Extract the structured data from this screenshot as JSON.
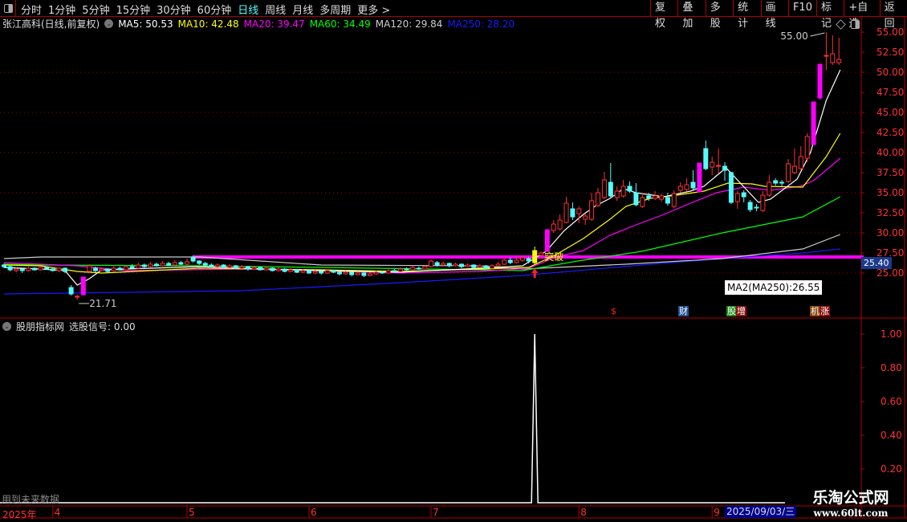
{
  "toolbar": {
    "tabs": [
      "分时",
      "1分钟",
      "5分钟",
      "15分钟",
      "30分钟",
      "60分钟",
      "日线",
      "周线",
      "月线",
      "多周期",
      "更多 >"
    ],
    "active_tab": "日线",
    "buttons": [
      "复权",
      "叠加",
      "多股",
      "统计",
      "画线",
      "F10",
      "标记",
      "+自选",
      "返回"
    ]
  },
  "info": {
    "title": "张江高科(日线,前复权)",
    "ma": [
      {
        "label": "MA5: 50.53",
        "color": "#ffffff"
      },
      {
        "label": "MA10: 42.48",
        "color": "#ffff00"
      },
      {
        "label": "MA20: 39.47",
        "color": "#ff00ff"
      },
      {
        "label": "MA60: 34.49",
        "color": "#00ff00"
      },
      {
        "label": "MA120: 29.84",
        "color": "#cccccc"
      },
      {
        "label": "MA250: 28.20",
        "color": "#1a1aff"
      }
    ]
  },
  "indicator": {
    "name": "股朋指标网",
    "signal_label": "选股信号: 0.00"
  },
  "annotations": {
    "high_label": "55.00",
    "low_label": "21.71",
    "breakout_label": "突破",
    "tooltip": "MA2(MA250):26.55",
    "current_price": "25.40",
    "future_warning": "用到未来数据",
    "year": "2025年",
    "date_box": "2025/09/03/三"
  },
  "event_badges": [
    {
      "text": "$",
      "color": "#ff2020",
      "bg": "transparent"
    },
    {
      "text": "财",
      "color": "#ffffff",
      "bg": "#1f4f8f"
    },
    {
      "text": "股",
      "color": "#ffffff",
      "bg": "#1a8a1a"
    },
    {
      "text": "增",
      "color": "#ffffff",
      "bg": "#8a1010"
    },
    {
      "text": "机",
      "color": "#ffffff",
      "bg": "#8a4a10"
    },
    {
      "text": "涨",
      "color": "#ffffff",
      "bg": "#8a1010"
    }
  ],
  "watermark": {
    "line1": "乐淘公式网",
    "line2": "www.60lt.com"
  },
  "chart_data": {
    "type": "candlestick",
    "price_axis": {
      "ticks": [
        55.0,
        52.5,
        50.0,
        47.5,
        45.0,
        42.5,
        40.0,
        37.5,
        35.0,
        32.5,
        30.0,
        27.5,
        25.0
      ],
      "grid": [
        50,
        45,
        40,
        35,
        30,
        25
      ]
    },
    "months": [
      "4",
      "5",
      "6",
      "7",
      "8",
      "9"
    ],
    "month_start_index": [
      8,
      30,
      50,
      70,
      94,
      115
    ],
    "resistance_level": 27.0,
    "resistance_start_index": 31,
    "candles": [
      [
        26.0,
        25.8,
        26.2,
        25.6
      ],
      [
        25.8,
        25.4,
        25.9,
        25.2
      ],
      [
        25.3,
        25.5,
        25.7,
        25.1
      ],
      [
        25.5,
        25.3,
        25.6,
        25.0
      ],
      [
        25.3,
        25.6,
        25.8,
        25.2
      ],
      [
        25.6,
        25.4,
        25.7,
        25.3
      ],
      [
        25.4,
        25.7,
        25.9,
        25.3
      ],
      [
        25.7,
        25.5,
        25.8,
        25.4
      ],
      [
        25.5,
        25.3,
        25.6,
        25.2
      ],
      [
        25.3,
        25.6,
        25.7,
        25.1
      ],
      [
        25.6,
        25.2,
        25.7,
        25.0
      ],
      [
        23.2,
        22.4,
        23.5,
        22.2
      ],
      [
        22.0,
        22.1,
        22.3,
        21.71
      ],
      [
        22.3,
        24.5,
        24.5,
        22.3
      ],
      [
        25.2,
        25.9,
        26.1,
        25.0
      ],
      [
        25.6,
        25.3,
        25.8,
        25.1
      ],
      [
        25.3,
        25.5,
        25.7,
        25.2
      ],
      [
        25.5,
        25.2,
        25.6,
        25.0
      ],
      [
        25.3,
        25.6,
        26.0,
        25.2
      ],
      [
        25.6,
        25.4,
        25.8,
        25.3
      ],
      [
        25.4,
        25.8,
        26.0,
        25.3
      ],
      [
        25.8,
        25.6,
        26.1,
        25.5
      ],
      [
        25.6,
        26.0,
        26.3,
        25.5
      ],
      [
        26.0,
        25.8,
        26.2,
        25.6
      ],
      [
        25.8,
        26.1,
        26.4,
        25.7
      ],
      [
        26.1,
        25.9,
        26.3,
        25.8
      ],
      [
        25.9,
        26.2,
        26.5,
        25.8
      ],
      [
        26.2,
        26.0,
        26.4,
        25.9
      ],
      [
        26.0,
        26.3,
        26.6,
        25.9
      ],
      [
        26.3,
        26.1,
        26.5,
        26.0
      ],
      [
        26.1,
        26.4,
        26.8,
        26.0
      ],
      [
        26.9,
        26.5,
        27.2,
        26.3
      ],
      [
        26.5,
        26.2,
        26.6,
        26.0
      ],
      [
        26.2,
        26.0,
        26.4,
        25.8
      ],
      [
        26.0,
        25.8,
        26.2,
        25.7
      ],
      [
        25.8,
        26.0,
        26.2,
        25.6
      ],
      [
        26.0,
        25.7,
        26.1,
        25.5
      ],
      [
        25.7,
        25.9,
        26.1,
        25.6
      ],
      [
        25.9,
        25.6,
        26.0,
        25.5
      ],
      [
        25.6,
        25.8,
        26.0,
        25.5
      ],
      [
        25.8,
        25.5,
        25.9,
        25.3
      ],
      [
        25.5,
        25.7,
        25.9,
        25.4
      ],
      [
        25.7,
        25.4,
        25.8,
        25.3
      ],
      [
        25.4,
        25.6,
        25.8,
        25.3
      ],
      [
        25.6,
        25.3,
        25.7,
        25.2
      ],
      [
        25.3,
        25.5,
        25.7,
        25.2
      ],
      [
        25.5,
        25.2,
        25.6,
        25.1
      ],
      [
        25.2,
        25.4,
        25.6,
        25.1
      ],
      [
        25.4,
        25.1,
        25.5,
        25.0
      ],
      [
        25.1,
        25.3,
        25.5,
        25.0
      ],
      [
        25.3,
        25.0,
        25.4,
        24.9
      ],
      [
        25.0,
        25.2,
        25.4,
        24.9
      ],
      [
        25.2,
        25.0,
        25.3,
        24.8
      ],
      [
        25.0,
        25.3,
        25.5,
        24.9
      ],
      [
        25.3,
        25.1,
        25.4,
        25.0
      ],
      [
        25.1,
        24.9,
        25.2,
        24.7
      ],
      [
        24.9,
        25.1,
        25.3,
        24.8
      ],
      [
        25.1,
        24.8,
        25.2,
        24.6
      ],
      [
        24.8,
        25.0,
        25.2,
        24.7
      ],
      [
        25.0,
        24.7,
        25.1,
        24.5
      ],
      [
        24.7,
        24.9,
        25.1,
        24.6
      ],
      [
        24.9,
        25.1,
        25.3,
        24.8
      ],
      [
        25.1,
        25.0,
        25.3,
        24.9
      ],
      [
        25.0,
        25.3,
        25.5,
        24.9
      ],
      [
        25.3,
        25.2,
        25.5,
        25.0
      ],
      [
        25.2,
        25.5,
        25.7,
        25.1
      ],
      [
        25.5,
        25.4,
        25.7,
        25.3
      ],
      [
        25.4,
        25.7,
        25.9,
        25.3
      ],
      [
        25.6,
        25.5,
        25.8,
        25.4
      ],
      [
        25.5,
        25.8,
        26.0,
        25.4
      ],
      [
        25.8,
        26.5,
        26.7,
        25.7
      ],
      [
        26.3,
        26.0,
        26.5,
        25.8
      ],
      [
        26.0,
        26.2,
        26.4,
        25.9
      ],
      [
        26.2,
        25.9,
        26.3,
        25.7
      ],
      [
        25.9,
        26.1,
        26.3,
        25.8
      ],
      [
        26.1,
        25.8,
        26.2,
        25.6
      ],
      [
        25.8,
        26.0,
        26.2,
        25.7
      ],
      [
        26.0,
        25.7,
        26.1,
        25.5
      ],
      [
        25.7,
        25.9,
        26.1,
        25.6
      ],
      [
        25.9,
        25.6,
        26.0,
        25.5
      ],
      [
        25.6,
        25.9,
        26.1,
        25.5
      ],
      [
        25.9,
        26.1,
        26.4,
        25.8
      ],
      [
        26.1,
        26.6,
        26.8,
        26.0
      ],
      [
        26.6,
        26.3,
        26.9,
        26.1
      ],
      [
        26.3,
        26.6,
        27.2,
        26.2
      ],
      [
        26.6,
        26.9,
        27.1,
        26.4
      ],
      [
        26.8,
        26.5,
        27.0,
        26.2
      ],
      [
        26.3,
        27.8,
        28.3,
        26.0
      ],
      [
        27.2,
        27.5,
        27.7,
        27.0
      ],
      [
        27.7,
        30.4,
        30.4,
        27.7
      ],
      [
        30.3,
        31.1,
        31.6,
        30.0
      ],
      [
        30.5,
        31.6,
        32.3,
        30.3
      ],
      [
        31.3,
        33.7,
        34.5,
        31.2
      ],
      [
        33.0,
        32.0,
        33.8,
        31.6
      ],
      [
        32.4,
        33.0,
        33.3,
        31.2
      ],
      [
        31.7,
        32.1,
        32.4,
        31.0
      ],
      [
        31.7,
        34.0,
        35.0,
        31.5
      ],
      [
        33.4,
        35.0,
        35.6,
        33.2
      ],
      [
        34.4,
        36.6,
        37.6,
        34.2
      ],
      [
        36.3,
        34.6,
        38.7,
        34.3
      ],
      [
        34.4,
        35.2,
        35.8,
        34.0
      ],
      [
        34.6,
        35.8,
        36.6,
        34.4
      ],
      [
        35.8,
        35.2,
        36.4,
        35.0
      ],
      [
        35.0,
        33.5,
        36.2,
        33.3
      ],
      [
        33.3,
        34.4,
        35.0,
        33.1
      ],
      [
        34.6,
        34.3,
        35.0,
        34.0
      ],
      [
        34.3,
        34.6,
        35.2,
        34.1
      ],
      [
        34.2,
        34.6,
        34.9,
        33.9
      ],
      [
        34.4,
        33.7,
        35.0,
        33.4
      ],
      [
        33.3,
        34.9,
        35.3,
        33.1
      ],
      [
        35.3,
        35.8,
        36.3,
        35.0
      ],
      [
        35.4,
        36.0,
        36.8,
        35.2
      ],
      [
        36.3,
        35.6,
        37.8,
        35.4
      ],
      [
        35.1,
        38.7,
        38.7,
        35.1
      ],
      [
        40.5,
        38.0,
        41.5,
        37.8
      ],
      [
        38.2,
        38.8,
        39.5,
        37.2
      ],
      [
        38.3,
        38.4,
        40.5,
        37.4
      ],
      [
        38.3,
        37.8,
        38.8,
        36.5
      ],
      [
        37.5,
        33.8,
        37.6,
        33.6
      ],
      [
        33.9,
        34.9,
        35.2,
        33.0
      ],
      [
        35.0,
        34.5,
        35.3,
        33.8
      ],
      [
        33.8,
        32.9,
        34.1,
        32.6
      ],
      [
        33.2,
        33.1,
        33.6,
        32.7
      ],
      [
        32.8,
        34.7,
        35.2,
        32.6
      ],
      [
        34.7,
        36.3,
        37.2,
        34.5
      ],
      [
        36.5,
        36.2,
        36.8,
        35.9
      ],
      [
        36.3,
        36.2,
        36.6,
        35.8
      ],
      [
        36.4,
        38.6,
        39.2,
        36.2
      ],
      [
        37.5,
        38.3,
        40.5,
        37.3
      ],
      [
        38.0,
        39.5,
        40.8,
        37.8
      ],
      [
        39.3,
        42.0,
        42.4,
        38.8
      ],
      [
        41.0,
        46.3,
        46.3,
        41.0
      ],
      [
        46.8,
        51.0,
        51.0,
        46.6
      ],
      [
        52.0,
        52.1,
        55.0,
        50.3
      ],
      [
        51.2,
        52.3,
        54.6,
        50.9
      ],
      [
        51.2,
        51.6,
        54.3,
        50.9
      ]
    ],
    "special_candles": {
      "13": "limit-up",
      "87": "breakout",
      "89": "limit-up",
      "113": "limit-up",
      "131": "limit-up",
      "132": "limit-up"
    },
    "high_index": 133,
    "low_index": 12,
    "ma_series": [
      {
        "name": "MA5",
        "color": "#ffffff",
        "points": [
          [
            0,
            25.7
          ],
          [
            6,
            25.5
          ],
          [
            10,
            25.3
          ],
          [
            12,
            23.5
          ],
          [
            14,
            24.3
          ],
          [
            16,
            25.4
          ],
          [
            32,
            25.8
          ],
          [
            39,
            25.6
          ],
          [
            52,
            25.3
          ],
          [
            65,
            25.1
          ],
          [
            78,
            25.6
          ],
          [
            85,
            25.9
          ],
          [
            88.8,
            27.7
          ],
          [
            91.7,
            30.3
          ],
          [
            94.7,
            32.3
          ],
          [
            96.7,
            33.4
          ],
          [
            98.9,
            34.3
          ],
          [
            101,
            35.5
          ],
          [
            103,
            35.0
          ],
          [
            107.4,
            34.5
          ],
          [
            111.6,
            35.2
          ],
          [
            113.7,
            35.8
          ],
          [
            117.2,
            38.1
          ],
          [
            122.3,
            33.8
          ],
          [
            124.2,
            34.2
          ],
          [
            128.4,
            36.7
          ],
          [
            130.5,
            40.0
          ],
          [
            133,
            46.5
          ],
          [
            135.2,
            50.3
          ]
        ]
      },
      {
        "name": "MA10",
        "color": "#ffff00",
        "points": [
          [
            0,
            26.0
          ],
          [
            6,
            25.9
          ],
          [
            12,
            25.2
          ],
          [
            16,
            25.0
          ],
          [
            32,
            25.6
          ],
          [
            52,
            25.4
          ],
          [
            65,
            25.2
          ],
          [
            78,
            25.5
          ],
          [
            86,
            25.7
          ],
          [
            90.4,
            27.3
          ],
          [
            94.7,
            29.3
          ],
          [
            98.9,
            31.7
          ],
          [
            101.4,
            33.3
          ],
          [
            105.2,
            34.3
          ],
          [
            109.4,
            34.7
          ],
          [
            113.7,
            35.2
          ],
          [
            117.5,
            36.2
          ],
          [
            121.3,
            36.1
          ],
          [
            123.3,
            35.8
          ],
          [
            129.3,
            35.7
          ],
          [
            133,
            39.5
          ],
          [
            135.2,
            42.4
          ]
        ]
      },
      {
        "name": "MA20",
        "color": "#ff00ff",
        "points": [
          [
            0,
            26.3
          ],
          [
            12,
            25.9
          ],
          [
            20,
            25.3
          ],
          [
            39,
            25.5
          ],
          [
            52,
            25.3
          ],
          [
            65,
            25.0
          ],
          [
            78,
            25.2
          ],
          [
            86,
            25.6
          ],
          [
            90.4,
            27.0
          ],
          [
            94.7,
            27.8
          ],
          [
            98.9,
            29.7
          ],
          [
            103,
            31.0
          ],
          [
            107.4,
            32.3
          ],
          [
            111.6,
            33.7
          ],
          [
            115.7,
            35.0
          ],
          [
            120,
            35.7
          ],
          [
            124.2,
            35.3
          ],
          [
            128.9,
            35.8
          ],
          [
            131,
            36.5
          ],
          [
            135.2,
            39.3
          ]
        ]
      },
      {
        "name": "MA60",
        "color": "#00ff00",
        "points": [
          [
            0,
            26.1
          ],
          [
            6,
            26.0
          ],
          [
            32,
            25.9
          ],
          [
            52,
            25.7
          ],
          [
            78,
            25.4
          ],
          [
            85,
            25.3
          ],
          [
            93.8,
            26.5
          ],
          [
            103.9,
            27.7
          ],
          [
            116.6,
            30.0
          ],
          [
            129.3,
            32.0
          ],
          [
            135.2,
            34.5
          ]
        ]
      },
      {
        "name": "MA120",
        "color": "#cccccc",
        "points": [
          [
            0,
            26.8
          ],
          [
            6,
            27.0
          ],
          [
            32,
            27.0
          ],
          [
            52,
            26.0
          ],
          [
            78,
            25.9
          ],
          [
            85,
            25.5
          ],
          [
            101.4,
            26.1
          ],
          [
            116.6,
            26.8
          ],
          [
            129.3,
            28.0
          ],
          [
            135.2,
            29.8
          ]
        ]
      },
      {
        "name": "MA250",
        "color": "#1a1aff",
        "points": [
          [
            0,
            22.4
          ],
          [
            39,
            22.8
          ],
          [
            65,
            23.8
          ],
          [
            85,
            24.7
          ],
          [
            103.9,
            26.0
          ],
          [
            116.6,
            26.8
          ],
          [
            129.3,
            27.5
          ],
          [
            135.2,
            28.0
          ]
        ]
      }
    ],
    "indicator_series": {
      "name": "选股信号",
      "axis_ticks": [
        1.0,
        0.8,
        0.6,
        0.4,
        0.2
      ],
      "baseline": 0,
      "spikes": [
        {
          "index": 87,
          "value": 1.0
        }
      ]
    }
  }
}
